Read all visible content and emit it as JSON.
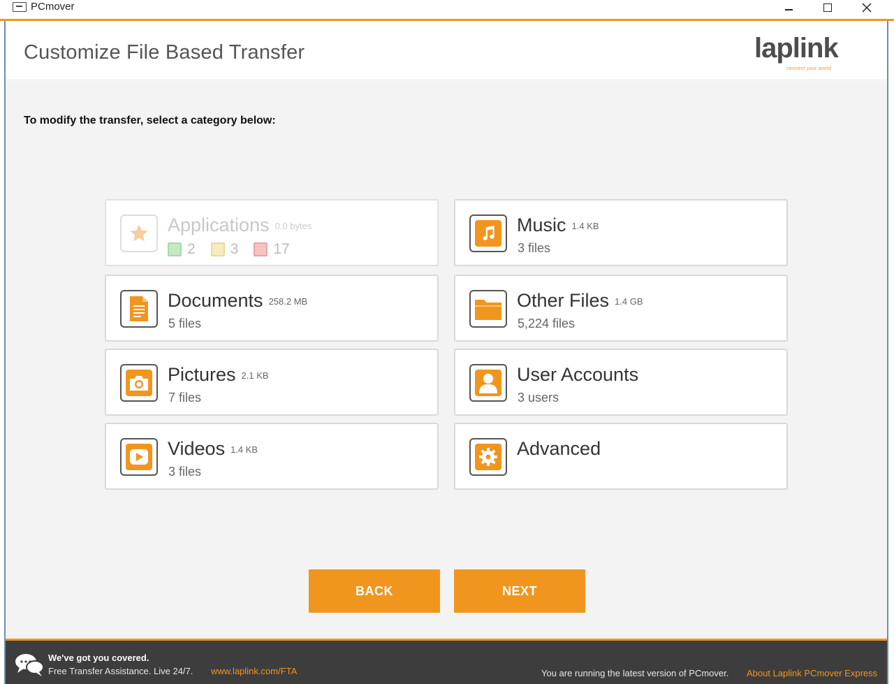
{
  "window": {
    "title": "PCmover"
  },
  "header": {
    "title": "Customize File Based Transfer",
    "logo_text": "laplink",
    "logo_tagline": "connect your world"
  },
  "main": {
    "instruction": "To modify the transfer, select a category below:",
    "categories": [
      {
        "name": "Applications",
        "size": "0.0 bytes",
        "stats": [
          "2",
          "3",
          "17"
        ],
        "icon": "star-icon",
        "enabled": false
      },
      {
        "name": "Music",
        "size": "1.4 KB",
        "detail": "3 files",
        "icon": "music-note-icon"
      },
      {
        "name": "Documents",
        "size": "258.2 MB",
        "detail": "5 files",
        "icon": "document-icon"
      },
      {
        "name": "Other Files",
        "size": "1.4 GB",
        "detail": "5,224 files",
        "icon": "folder-icon"
      },
      {
        "name": "Pictures",
        "size": "2.1 KB",
        "detail": "7 files",
        "icon": "camera-icon"
      },
      {
        "name": "User Accounts",
        "size": "",
        "detail": "3 users",
        "icon": "user-icon"
      },
      {
        "name": "Videos",
        "size": "1.4 KB",
        "detail": "3 files",
        "icon": "play-icon"
      },
      {
        "name": "Advanced",
        "size": "",
        "detail": "",
        "icon": "gear-icon"
      }
    ]
  },
  "buttons": {
    "back": "BACK",
    "next": "NEXT"
  },
  "footer": {
    "title": "We've got you covered.",
    "line": "Free Transfer Assistance. Live 24/7.",
    "link": "www.laplink.com/FTA",
    "version_text": "You are running the latest version of PCmover.",
    "about_link": "About Laplink PCmover Express"
  },
  "colors": {
    "accent": "#f0961e",
    "footer_bg": "#3d3d3d",
    "content_bg": "#f3f3f3"
  }
}
